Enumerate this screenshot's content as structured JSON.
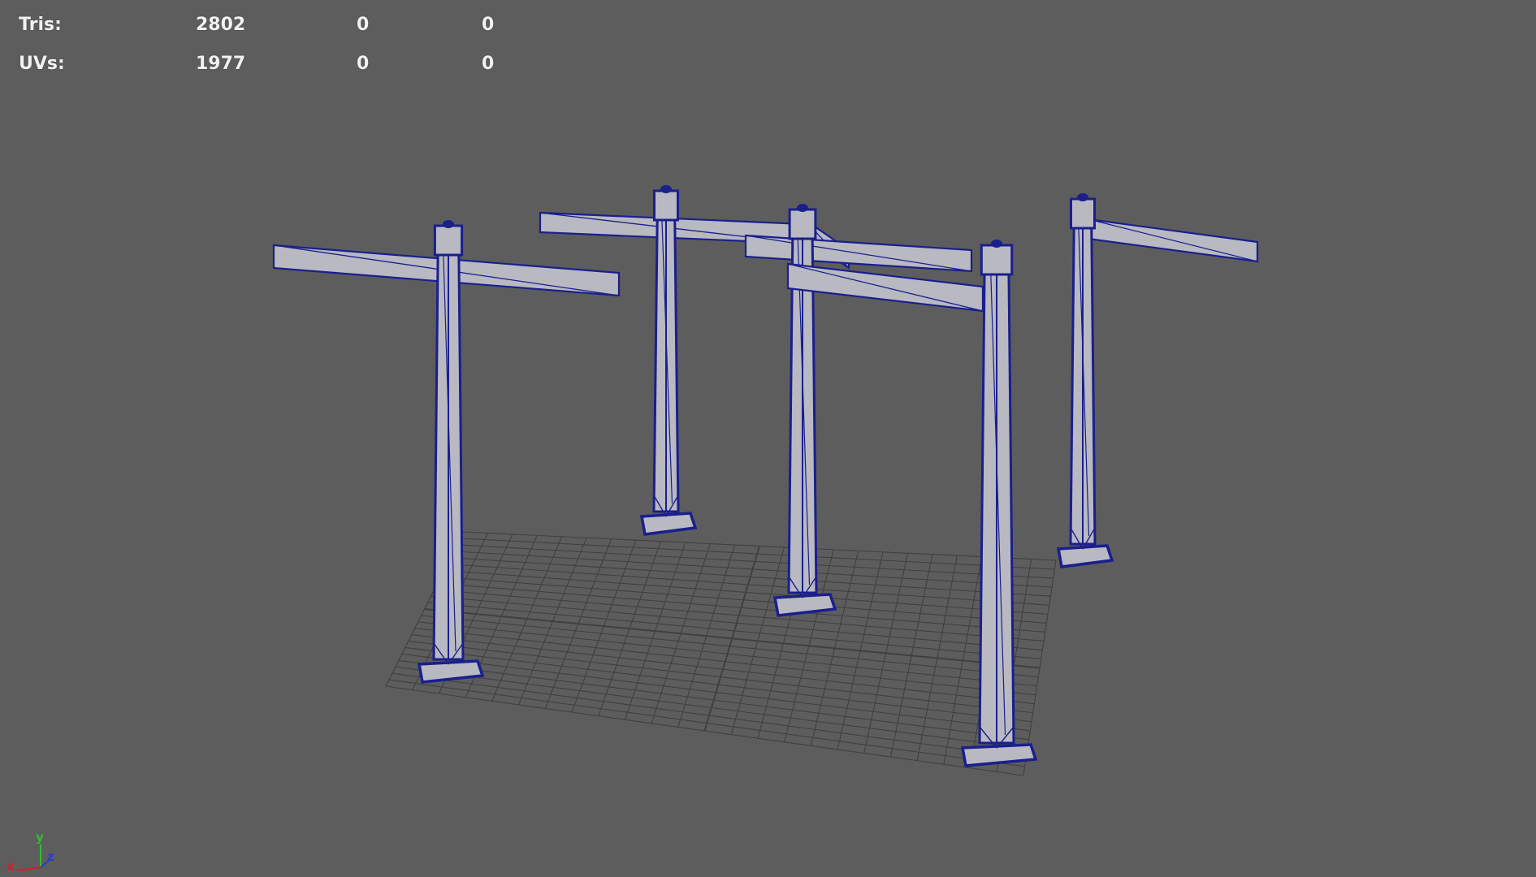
{
  "hud": {
    "rows": [
      {
        "label": "Tris:",
        "values": [
          "2802",
          "0",
          "0"
        ]
      },
      {
        "label": "UVs:",
        "values": [
          "1977",
          "0",
          "0"
        ]
      }
    ]
  },
  "axis": {
    "x_label": "x",
    "y_label": "y",
    "z_label": "z",
    "x_color": "#d42020",
    "y_color": "#2ec02e",
    "z_color": "#2a3ad8"
  },
  "colors": {
    "background": "#5d5d5d",
    "grid": "#3f3f3f",
    "wireframe": "#1a1f8c",
    "surface": "#b9b9c2"
  }
}
